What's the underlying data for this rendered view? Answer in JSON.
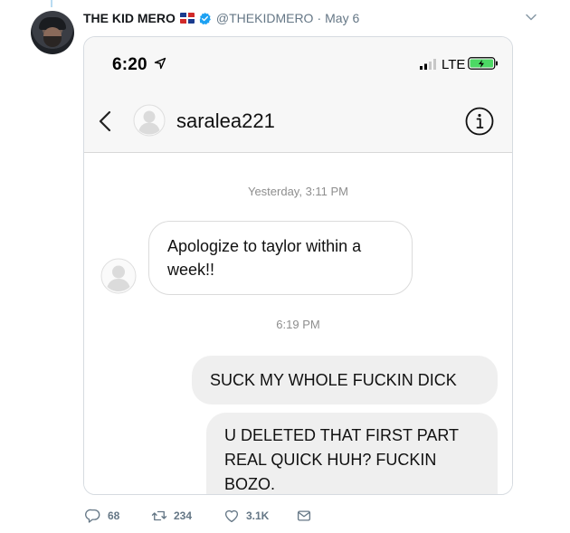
{
  "tweet": {
    "author_name": "THE KID MERO",
    "handle": "@THEKIDMERO",
    "separator": "·",
    "date": "May 6",
    "actions": {
      "replies": "68",
      "retweets": "234",
      "likes": "3.1K"
    }
  },
  "phone": {
    "time": "6:20",
    "network": "LTE",
    "contact_name": "saralea221",
    "messages": {
      "stamp_1": "Yesterday, 3:11 PM",
      "incoming_1": "Apologize to taylor within a week!!",
      "stamp_2": "6:19 PM",
      "outgoing_1": "SUCK MY WHOLE FUCKIN DICK",
      "outgoing_2": "U DELETED THAT FIRST PART REAL QUICK HUH? FUCKIN BOZO."
    }
  },
  "colors": {
    "verified_blue": "#1da1f2",
    "muted_text": "#657786",
    "outgoing_bubble": "#efefef",
    "battery_green": "#4cd964"
  },
  "icons": [
    "verified-icon",
    "dominican-flag-icon",
    "chevron-down-icon",
    "location-arrow-icon",
    "signal-icon",
    "battery-icon",
    "back-chevron-icon",
    "info-icon",
    "reply-icon",
    "retweet-icon",
    "like-icon",
    "message-icon"
  ]
}
